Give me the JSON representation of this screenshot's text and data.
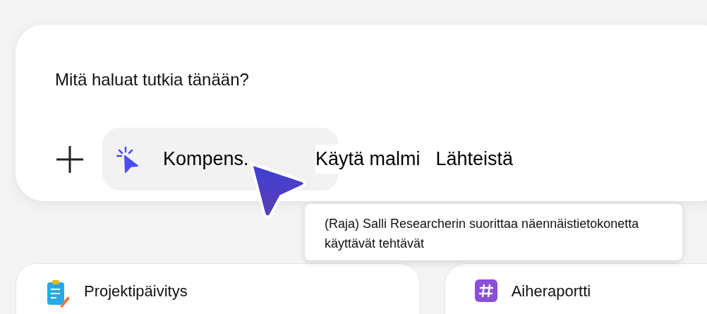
{
  "composer": {
    "placeholder": "Mitä haluat tutkia tänään?",
    "chip": {
      "label": "Kompens."
    },
    "options": [
      "Käytä malmi",
      "Lähteistä"
    ]
  },
  "tooltip": {
    "text": "(Raja) Salli Researcherin suorittaa näennäistietokonetta käyttävät tehtävät"
  },
  "cards": [
    {
      "kind": "notepad",
      "title": "Projektipäivitys"
    },
    {
      "kind": "hash",
      "title": "Aiheraportti"
    }
  ]
}
